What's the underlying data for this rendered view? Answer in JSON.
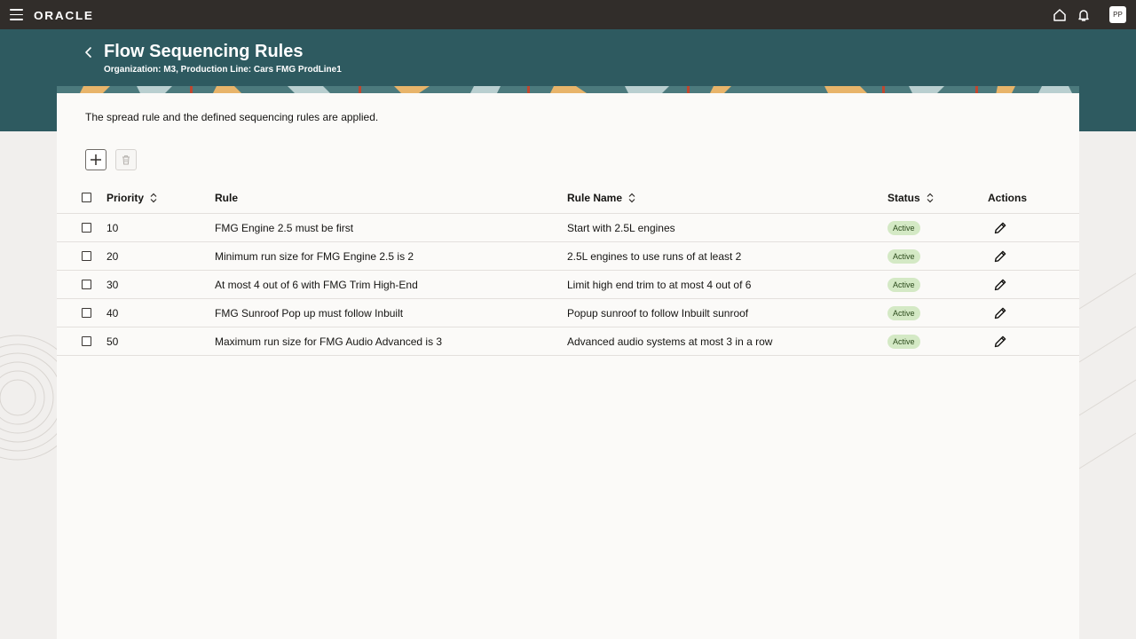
{
  "topbar": {
    "logo": "ORACLE",
    "avatar_initials": "PP",
    "icons": [
      "hamburger-menu-icon",
      "home-icon",
      "bell-icon"
    ]
  },
  "header": {
    "title": "Flow Sequencing Rules",
    "subtitle": "Organization: M3, Production Line: Cars FMG ProdLine1"
  },
  "main": {
    "info_text": "The spread rule and the defined sequencing rules are applied.",
    "toolbar": {
      "add_icon": "plus-icon",
      "delete_icon": "trash-icon"
    },
    "table": {
      "columns": {
        "priority": "Priority",
        "rule": "Rule",
        "rule_name": "Rule Name",
        "status": "Status",
        "actions": "Actions"
      },
      "rows": [
        {
          "priority": "10",
          "rule": "FMG Engine 2.5 must be first",
          "rule_name": "Start with 2.5L engines",
          "status": "Active"
        },
        {
          "priority": "20",
          "rule": "Minimum run size for FMG Engine 2.5 is 2",
          "rule_name": "2.5L engines to use runs of at least 2",
          "status": "Active"
        },
        {
          "priority": "30",
          "rule": "At most 4 out of 6 with FMG Trim High-End",
          "rule_name": "Limit high end trim to at most 4 out of 6",
          "status": "Active"
        },
        {
          "priority": "40",
          "rule": "FMG Sunroof Pop up must follow Inbuilt",
          "rule_name": "Popup sunroof to follow Inbuilt sunroof",
          "status": "Active"
        },
        {
          "priority": "50",
          "rule": "Maximum run size for FMG Audio Advanced is 3",
          "rule_name": "Advanced audio systems at most 3 in a row",
          "status": "Active"
        }
      ]
    }
  },
  "colors": {
    "topbar": "#312d2a",
    "header_band": "#2e5a60",
    "badge_bg": "#d4e9c5",
    "card_bg": "#fbfaf8"
  }
}
